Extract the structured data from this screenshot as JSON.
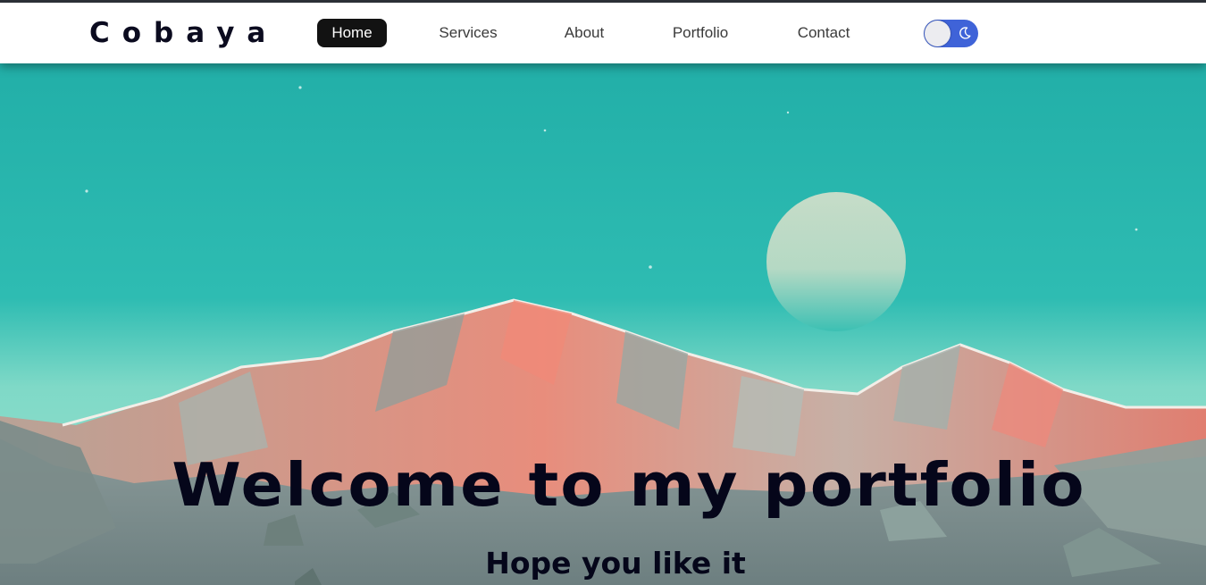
{
  "brand": {
    "name": "Cobaya"
  },
  "nav": {
    "items": [
      {
        "label": "Home",
        "active": true
      },
      {
        "label": "Services",
        "active": false
      },
      {
        "label": "About",
        "active": false
      },
      {
        "label": "Portfolio",
        "active": false
      },
      {
        "label": "Contact",
        "active": false
      }
    ]
  },
  "theme_toggle": {
    "icon": "moon-icon",
    "state": "off"
  },
  "hero": {
    "title": "Welcome to my portfolio",
    "subtitle": "Hope you like it",
    "background": "low-poly mountain landscape with moon"
  },
  "colors": {
    "nav_active_bg": "#121212",
    "toggle_bg": "#3f63d8",
    "sky": "#26b3ad",
    "text_dark": "#05061a"
  }
}
